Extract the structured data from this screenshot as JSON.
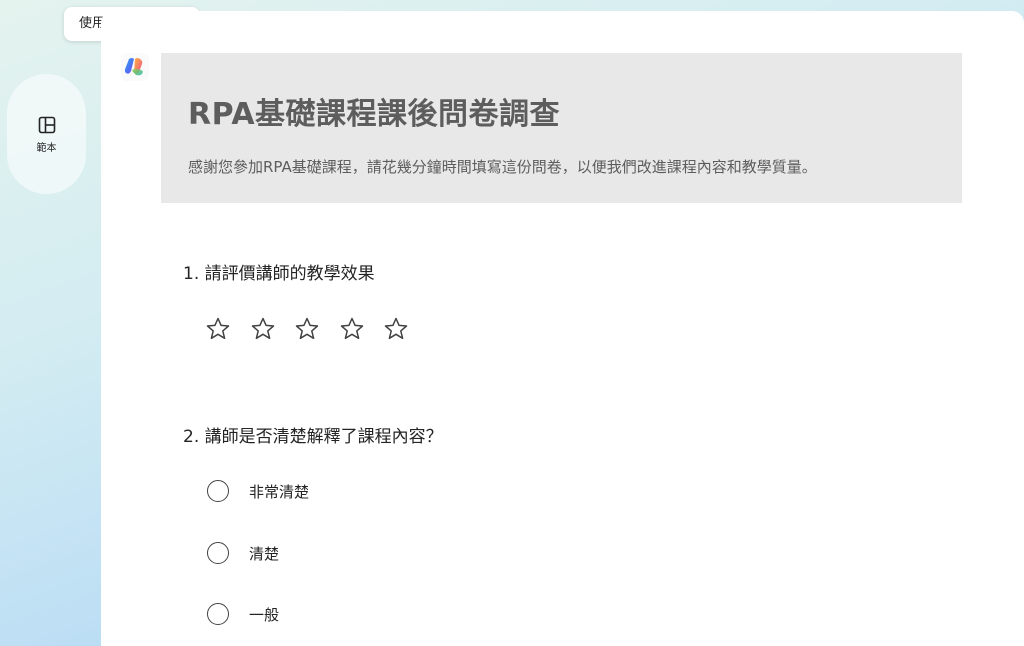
{
  "tooltip": {
    "text": "使用 Copilot 重寫"
  },
  "sidebar": {
    "template_label": "範本",
    "template_icon": "layout-panel-icon"
  },
  "copilot": {
    "icon": "copilot-icon"
  },
  "form": {
    "title": "RPA基礎課程課後問卷調查",
    "description": "感謝您參加RPA基礎課程，請花幾分鐘時間填寫這份問卷，以便我們改進課程內容和教學質量。"
  },
  "questions": [
    {
      "label": "1. 請評價講師的教學效果",
      "type": "rating",
      "max_stars": 5,
      "rating": 0
    },
    {
      "label": "2. 講師是否清楚解釋了課程內容？",
      "type": "choice",
      "options": [
        "非常清楚",
        "清楚",
        "一般"
      ]
    }
  ]
}
